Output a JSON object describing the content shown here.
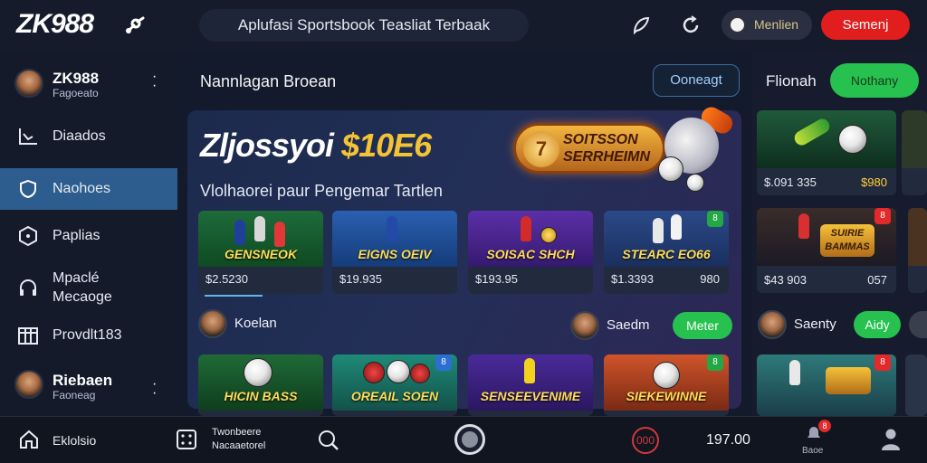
{
  "header": {
    "logo": "ZK988",
    "search_text": "Aplufasi Sportsbook Teasliat Terbaak",
    "pill_label": "Menlien",
    "red_button": "Semenj",
    "icons": [
      "link-icon",
      "feather-icon",
      "refresh-icon",
      "soccer-ball-icon"
    ]
  },
  "sidebar": {
    "profile_top": {
      "name": "ZK988",
      "sub": "Fagoeato"
    },
    "items": [
      {
        "label": "Diaados",
        "icon": "stats-icon"
      },
      {
        "label": "Naohoes",
        "icon": "shield-icon",
        "active": true
      },
      {
        "label": "Paplias",
        "icon": "hexagon-icon"
      },
      {
        "label": "Mpaclé",
        "label2": "Mecaoge",
        "icon": "headset-icon"
      },
      {
        "label": "Provdlt183",
        "icon": "calendar-icon"
      }
    ],
    "profile_bottom": {
      "name": "Riebaen",
      "sub": "Faoneag"
    }
  },
  "main": {
    "section_title": "Nannlagan Broean",
    "outline_button": "Ooneagt",
    "banner": {
      "title_white": "Zljossyoi",
      "title_gold": "$10E6",
      "subtitle": "Vlolhaorei paur Pengemar Tartlen",
      "badge_coin": "7",
      "badge_line1": "SOITSSON",
      "badge_line2": "SERRHEIMN"
    },
    "cards_row1": [
      {
        "title": "GENSNEOK",
        "value": "$2.5230",
        "value2": ""
      },
      {
        "title": "EIGNS OEIV",
        "value": "$19.935",
        "value2": ""
      },
      {
        "title": "SOISAC SHCH",
        "value": "$193.95",
        "value2": ""
      },
      {
        "title": "STEARC EO66",
        "value": "$1.3393",
        "value2": "980",
        "badge": "8"
      }
    ],
    "users_row": [
      {
        "name": "Koelan"
      },
      {
        "name": "Saedm",
        "button": "Meter"
      }
    ],
    "cards_row2": [
      {
        "title": "HICIN BASS"
      },
      {
        "title": "OREAIL SOEN",
        "badge": "8"
      },
      {
        "title": "SENSEEVENIME"
      },
      {
        "title": "SIEKEWINNE",
        "badge": "8"
      }
    ]
  },
  "right_panel": {
    "title": "Flionah",
    "button": "Nothany",
    "cards": [
      {
        "value": "$.091 335",
        "value2": "$980"
      },
      {
        "title": "SUIRIE\nBAMMAS",
        "value": "$43 903",
        "value2": "057",
        "badge": "8"
      }
    ],
    "user": {
      "name": "Saenty",
      "button": "Aidy"
    },
    "card3_badge": "8"
  },
  "bottom_bar": {
    "home_label": "Eklolsio",
    "dice_line1": "Twonbeere",
    "dice_line2": "Nacaaetorel",
    "amount": "197.00",
    "bell_label": "Baoe",
    "bell_count": "8"
  },
  "colors": {
    "accent_green": "#26c14f",
    "accent_red": "#e21d1d",
    "active_nav": "#2d5d8e",
    "gold": "#f3c235"
  }
}
